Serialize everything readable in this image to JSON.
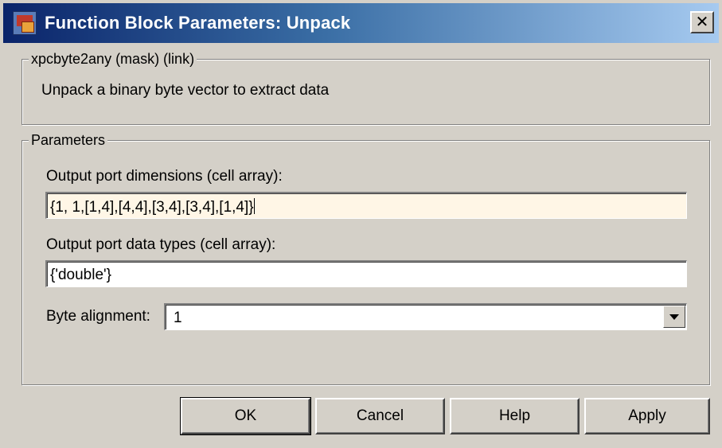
{
  "window": {
    "title": "Function Block Parameters: Unpack",
    "icon": "simulink-block-icon",
    "close_label": "✕"
  },
  "mask_group": {
    "legend": "xpcbyte2any (mask) (link)",
    "description": "Unpack a binary byte vector to extract data"
  },
  "params_group": {
    "legend": "Parameters",
    "dims_label": "Output port dimensions (cell array):",
    "dims_value": "{1, 1,[1,4],[4,4],[3,4],[3,4],[1,4]}",
    "types_label": "Output port data types (cell array):",
    "types_value": "{'double'}",
    "align_label": "Byte alignment:",
    "align_value": "1"
  },
  "buttons": {
    "ok": "OK",
    "cancel": "Cancel",
    "help": "Help",
    "apply": "Apply"
  },
  "colors": {
    "titlebar_start": "#0a246a",
    "titlebar_end": "#a6caf0",
    "face": "#d4d0c8",
    "active_field": "#fff6e6"
  }
}
